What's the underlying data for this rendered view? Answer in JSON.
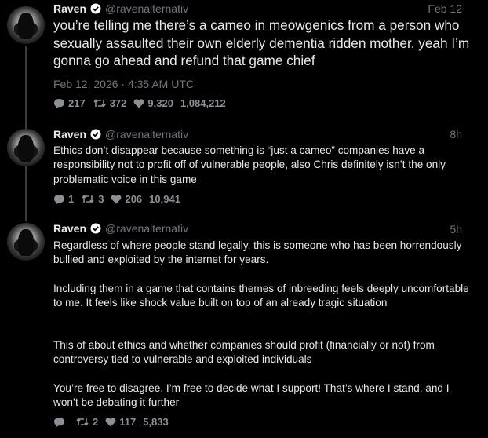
{
  "tweets": [
    {
      "name": "Raven",
      "handle": "@ravenalternativ",
      "time": "Feb 12",
      "text": "you’re telling me there’s a cameo in meowgenics from a person who sexually assaulted their own elderly dementia ridden mother, yeah I’m gonna go ahead and refund that game chief",
      "date": "Feb 12, 2026 · 4:35 AM UTC",
      "replies": "217",
      "retweets": "372",
      "likes": "9,320",
      "views": "1,084,212"
    },
    {
      "name": "Raven",
      "handle": "@ravenalternativ",
      "time": "8h",
      "text": "Ethics don’t disappear because something is “just a cameo” companies have a responsibility not to profit off of vulnerable people, also Chris definitely isn’t the only problematic voice in this game",
      "replies": "1",
      "retweets": "3",
      "likes": "206",
      "views": "10,941"
    },
    {
      "name": "Raven",
      "handle": "@ravenalternativ",
      "time": "5h",
      "paragraphs": [
        "Regardless of where people stand legally, this is someone who has been horrendously bullied and exploited by the internet for years.",
        "Including them in a game that contains themes of inbreeding feels deeply uncomfortable to me. It feels like shock value built on top of an already tragic situation",
        "This of about ethics and whether companies should profit (financially or not) from controversy tied to vulnerable and exploited individuals",
        "You’re free to disagree. I’m free to decide what I support! That’s where I stand, and I won’t be debating it further"
      ],
      "replies": "",
      "retweets": "2",
      "likes": "117",
      "views": "5,833"
    }
  ],
  "colors": {
    "text": "#e7e9ea",
    "muted": "#71767b",
    "verified": "#ffffff",
    "background": "#000000"
  },
  "icons": [
    "reply-icon",
    "retweet-icon",
    "like-icon",
    "verified-icon"
  ]
}
